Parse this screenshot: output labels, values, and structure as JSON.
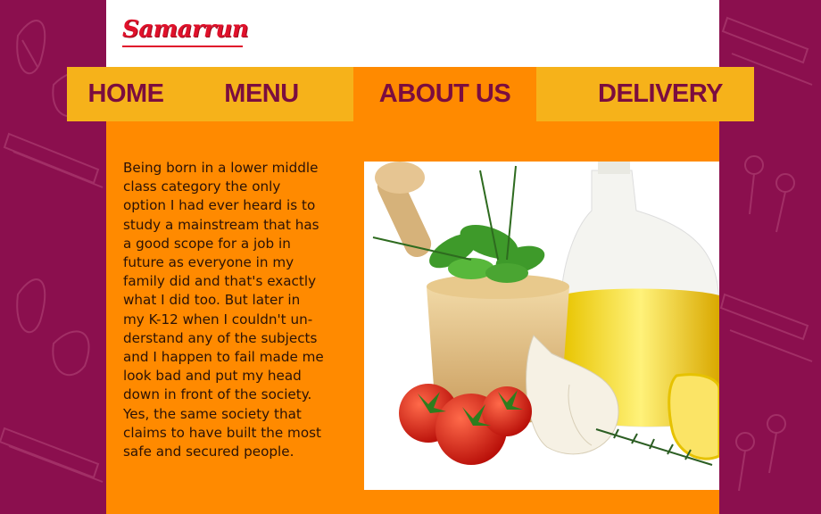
{
  "brand": {
    "name": "Samarrun"
  },
  "nav": {
    "items": [
      {
        "label": "HOME",
        "active": false
      },
      {
        "label": "MENU",
        "active": false
      },
      {
        "label": "ABOUT US",
        "active": true
      },
      {
        "label": "DELIVERY",
        "active": false
      }
    ]
  },
  "about": {
    "lines": [
      "Being born in a lower middle",
      "class category the only",
      "option I had ever heard is to",
      "study a mainstream that has",
      "a good scope for a job in",
      "future as everyone in my",
      "family did and that's exactly",
      "what I did too. But later in",
      "my K-12 when I couldn't un-",
      "derstand any of the subjects",
      "and I happen to fail made me",
      "look bad and put my head",
      "down in front of the society.",
      "Yes, the same society that",
      "claims to have built the most",
      "safe and secured people."
    ]
  },
  "photo": {
    "subject": "olive oil, herbs, mortar, tomatoes, garlic, lemon"
  },
  "colors": {
    "background": "#8b0f4e",
    "content": "#ff8a00",
    "nav": "#f6b21a",
    "nav_text": "#7b0d3f",
    "logo": "#e0112b"
  }
}
